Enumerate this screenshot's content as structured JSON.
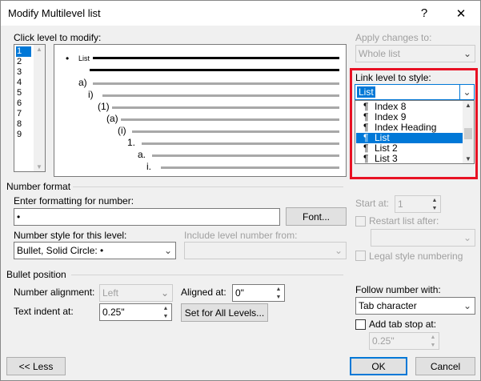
{
  "window": {
    "title": "Modify Multilevel list",
    "help_glyph": "?",
    "close_glyph": "✕"
  },
  "level_panel": {
    "label": "Click level to modify:",
    "levels": [
      "1",
      "2",
      "3",
      "4",
      "5",
      "6",
      "7",
      "8",
      "9"
    ],
    "selected": "1"
  },
  "preview": {
    "bullet": "•",
    "level1_text": "List",
    "markers": [
      "a)",
      "i)",
      "(1)",
      "(a)",
      "(i)",
      "1.",
      "a.",
      "i."
    ]
  },
  "apply_changes": {
    "label": "Apply changes to:",
    "value": "Whole list"
  },
  "link_level": {
    "label": "Link level to style:",
    "value": "List",
    "items": [
      "Index 8",
      "Index 9",
      "Index Heading",
      "List",
      "List 2",
      "List 3"
    ],
    "selected": "List"
  },
  "number_format": {
    "section": "Number format",
    "enter_label": "Enter formatting for number:",
    "value": "•",
    "font_button": "Font...",
    "style_label": "Number style for this level:",
    "style_value": "Bullet, Solid Circle: •",
    "include_label": "Include level number from:",
    "include_value": ""
  },
  "start_at": {
    "label": "Start at:",
    "value": "1"
  },
  "restart": {
    "label": "Restart list after:",
    "value": ""
  },
  "legal": {
    "label": "Legal style numbering"
  },
  "bullet_position": {
    "section": "Bullet position",
    "alignment_label": "Number alignment:",
    "alignment_value": "Left",
    "aligned_at_label": "Aligned at:",
    "aligned_at_value": "0\"",
    "indent_label": "Text indent at:",
    "indent_value": "0.25\"",
    "set_all_button": "Set for All Levels..."
  },
  "follow": {
    "label": "Follow number with:",
    "value": "Tab character",
    "add_tab_label": "Add tab stop at:",
    "tab_value": "0.25\""
  },
  "buttons": {
    "less": "<< Less",
    "ok": "OK",
    "cancel": "Cancel"
  }
}
